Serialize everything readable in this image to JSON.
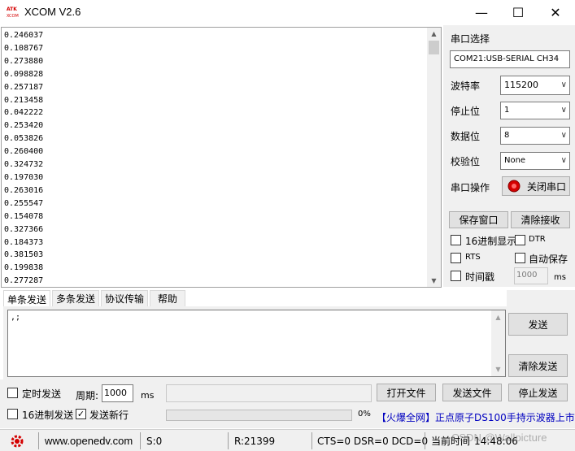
{
  "window": {
    "title": "XCOM V2.6",
    "logo_top": "ATK",
    "logo_bottom": "XCOM",
    "minimize": "—",
    "maximize": "☐",
    "close": "✕"
  },
  "receive": {
    "lines": [
      "0.246037",
      "0.108767",
      "0.273880",
      "0.098828",
      "0.257187",
      "0.213458",
      "0.042222",
      "0.253420",
      "0.053826",
      "0.260400",
      "0.324732",
      "0.197030",
      "0.263016",
      "0.255547",
      "0.154078",
      "0.327366",
      "0.184373",
      "0.381503",
      "0.199838",
      "0.277287"
    ]
  },
  "panel": {
    "port_select_label": "串口选择",
    "port_value": "COM21:USB-SERIAL CH34",
    "baud_label": "波特率",
    "baud_value": "115200",
    "stopbits_label": "停止位",
    "stopbits_value": "1",
    "databits_label": "数据位",
    "databits_value": "8",
    "parity_label": "校验位",
    "parity_value": "None",
    "port_op_label": "串口操作",
    "close_port_label": "关闭串口",
    "save_window_label": "保存窗口",
    "clear_recv_label": "清除接收",
    "hex_display_label": "16进制显示",
    "dtr_label": "DTR",
    "rts_label": "RTS",
    "autosave_label": "自动保存",
    "timestamp_label": "时间戳",
    "timestamp_value": "1000",
    "ms_label": "ms"
  },
  "tabs": [
    "单条发送",
    "多条发送",
    "协议传输",
    "帮助"
  ],
  "send": {
    "text": ",;",
    "send_label": "发送",
    "clear_send_label": "清除发送",
    "timed_send_label": "定时发送",
    "period_label": "周期:",
    "period_value": "1000",
    "ms_label": "ms",
    "open_file_label": "打开文件",
    "send_file_label": "发送文件",
    "stop_send_label": "停止发送",
    "hex_send_label": "16进制发送",
    "newline_label": "发送新行",
    "newline_checked": "✓",
    "progress_pct": "0%",
    "progress_value": 0,
    "ad_text": "【火爆全网】正点原子DS100手持示波器上市"
  },
  "status": {
    "website": "www.openedv.com",
    "sent": "S:0",
    "received": "R:21399",
    "lines": "CTS=0 DSR=0 DCD=0",
    "time_label": "当前时间",
    "time_value": "14:48:06",
    "watermark": "CSDN @Wallpicture"
  },
  "colors": {
    "accent": "#d40000",
    "ad_blue": "#0000c0",
    "ad_red": "#c00000"
  }
}
